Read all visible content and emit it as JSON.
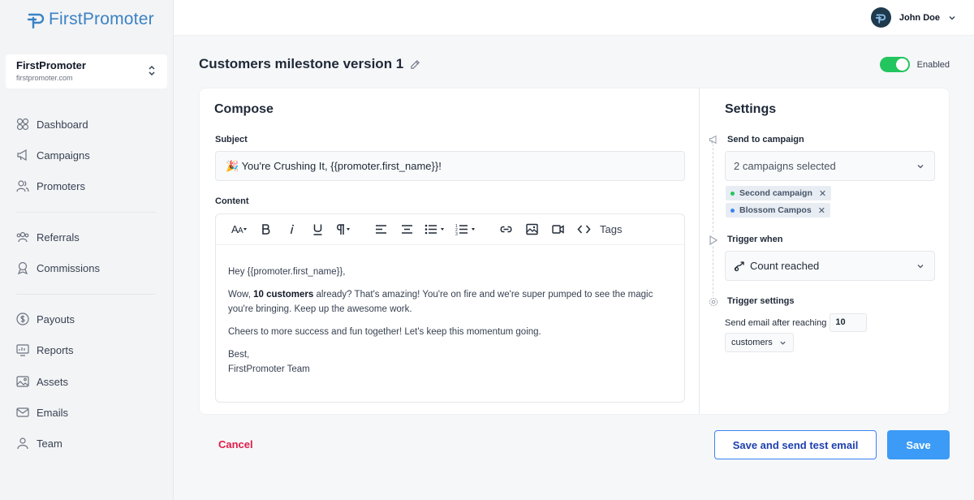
{
  "brand": {
    "name": "FirstPromoter"
  },
  "org": {
    "name": "FirstPromoter",
    "url": "firstpromoter.com"
  },
  "nav": {
    "dashboard": "Dashboard",
    "campaigns": "Campaigns",
    "promoters": "Promoters",
    "referrals": "Referrals",
    "commissions": "Commissions",
    "payouts": "Payouts",
    "reports": "Reports",
    "assets": "Assets",
    "emails": "Emails",
    "team": "Team"
  },
  "user": {
    "name": "John Doe"
  },
  "page": {
    "title": "Customers milestone version 1",
    "enabled_label": "Enabled",
    "enabled": true
  },
  "compose": {
    "title": "Compose",
    "subject_label": "Subject",
    "subject_value": "🎉 You're Crushing It, {{promoter.first_name}}!",
    "content_label": "Content",
    "toolbar_tags": "Tags",
    "body": {
      "greeting": "Hey {{promoter.first_name}},",
      "p1_before": "Wow, ",
      "p1_bold": "10 customers",
      "p1_after": " already? That's amazing! You're on fire and we're super pumped to see the magic you're bringing. Keep up the awesome work.",
      "p2": "Cheers to more success and fun together! Let's keep this momentum going.",
      "signoff": "Best,",
      "signature": "FirstPromoter Team"
    }
  },
  "settings": {
    "title": "Settings",
    "send_label": "Send to campaign",
    "campaigns_select": "2 campaigns selected",
    "chips": [
      {
        "label": "Second campaign",
        "color": "#22c55e"
      },
      {
        "label": "Blossom Campos",
        "color": "#3b82f6"
      }
    ],
    "trigger_when_label": "Trigger when",
    "trigger_value": "Count reached",
    "trigger_settings_label": "Trigger settings",
    "reach_text": "Send email after reaching",
    "reach_value": "10",
    "unit": "customers"
  },
  "footer": {
    "cancel": "Cancel",
    "test": "Save and send test email",
    "save": "Save"
  },
  "colors": {
    "accent": "#3b9bf6",
    "danger": "#e11d48",
    "toggle": "#22c55e"
  }
}
